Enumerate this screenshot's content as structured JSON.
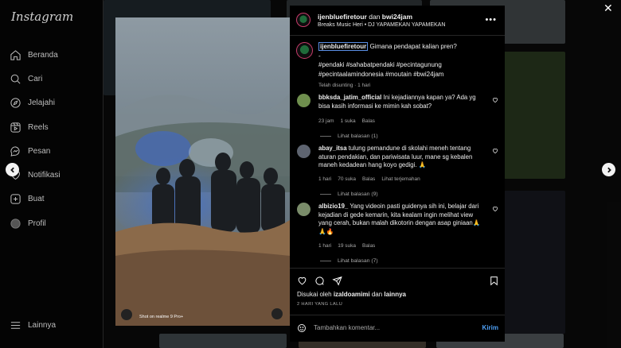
{
  "app": {
    "logo": "Instagram"
  },
  "sidebar": {
    "items": [
      {
        "label": "Beranda",
        "icon": "home-icon"
      },
      {
        "label": "Cari",
        "icon": "search-icon"
      },
      {
        "label": "Jelajahi",
        "icon": "compass-icon"
      },
      {
        "label": "Reels",
        "icon": "reels-icon"
      },
      {
        "label": "Pesan",
        "icon": "messenger-icon"
      },
      {
        "label": "Notifikasi",
        "icon": "heart-icon"
      },
      {
        "label": "Buat",
        "icon": "plus-square-icon"
      },
      {
        "label": "Profil",
        "icon": "avatar-icon"
      }
    ],
    "more": "Lainnya"
  },
  "post": {
    "author": "ijenbluefiretour",
    "connector": " dan ",
    "collab": "bwi24jam",
    "audio": "Breaks Music Heri • DJ YAPAMEKAN YAPAMEKAN",
    "caption_user": "ijenbluefiretour",
    "caption_text": "Gimana pendapat kalian pren?",
    "caption_dash": "-",
    "hashtags_1": "#pendaki #sahabatpendaki #pecintagunung",
    "hashtags_2": "#pecintaalamindonesia #moutain #bwi24jam",
    "caption_meta": "Telah disunting · 1 hari",
    "media_overlay": "Shot on realme 9 Pro+"
  },
  "comments": [
    {
      "user": "bbksda_jatim_official",
      "text": "Ini kejadiannya kapan ya? Ada yg bisa kasih informasi ke mimin kah sobat?",
      "time": "23 jam",
      "likes": "1 suka",
      "reply": "Balas",
      "translate": "",
      "replies": "Lihat balasan (1)",
      "avatar_color": "#6f8f4e"
    },
    {
      "user": "abay_itsa",
      "text": "tulung pemandune di skolahi meneh tentang aturan pendakian, dan pariwisata luur, mane sg kebalen maneh kedadean hang koyo gedigi. 🙏",
      "time": "1 hari",
      "likes": "70 suka",
      "reply": "Balas",
      "translate": "Lihat terjemahan",
      "replies": "Lihat balasan (9)",
      "avatar_color": "#5e6470"
    },
    {
      "user": "albizio19_",
      "text": "Yang videoin pasti guidenya sih ini, belajar dari kejadian di gede kemarin, kita kealam ingin melihat view yang cerah, bukan malah dikotorin dengan asap giniaan🙏🙏🔥",
      "time": "1 hari",
      "likes": "19 suka",
      "reply": "Balas",
      "translate": "",
      "replies": "Lihat balasan (7)",
      "avatar_color": "#7a8c6a"
    }
  ],
  "likes": {
    "prefix": "Disukai oleh ",
    "user": "izaldoamimi",
    "and": " dan ",
    "others": "lainnya"
  },
  "date": "2 HARI YANG LALU",
  "add_comment": {
    "placeholder": "Tambahkan komentar...",
    "post": "Kirim"
  },
  "colors": {
    "accent": "#4ea0f5",
    "background": "#000000",
    "story_ring": "#c83b6b"
  }
}
